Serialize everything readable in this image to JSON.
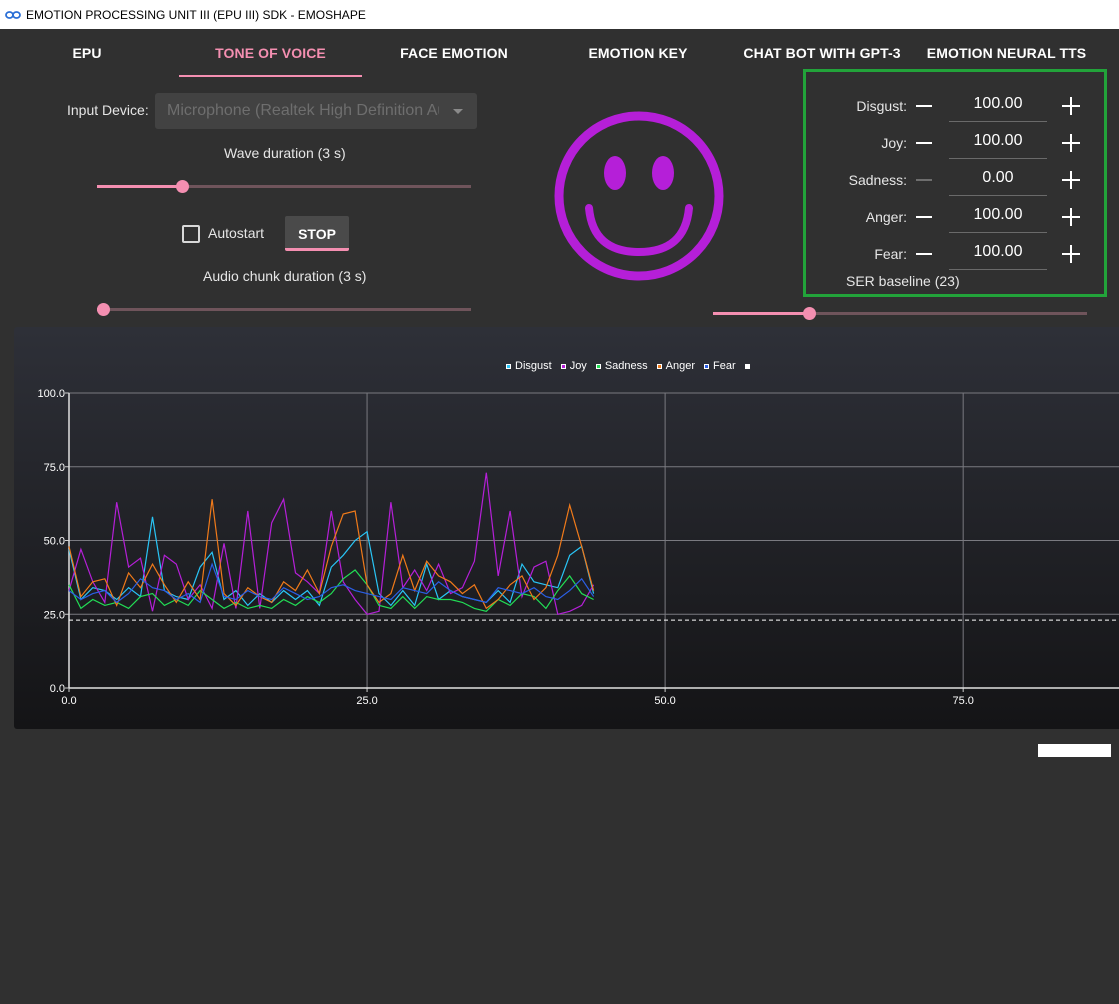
{
  "window": {
    "title": "EMOTION PROCESSING UNIT III (EPU III) SDK - EMOSHAPE",
    "icon": "infinity-icon"
  },
  "tabs": [
    {
      "label": "EPU",
      "active": false
    },
    {
      "label": "TONE OF VOICE",
      "active": true
    },
    {
      "label": "FACE EMOTION",
      "active": false
    },
    {
      "label": "EMOTION KEY",
      "active": false
    },
    {
      "label": "CHAT BOT WITH GPT-3",
      "active": false
    },
    {
      "label": "EMOTION NEURAL TTS",
      "active": false
    }
  ],
  "input_device": {
    "label": "Input Device:",
    "value": "Microphone (Realtek High Definition Audio)"
  },
  "wave_duration": {
    "label": "Wave duration (3 s)",
    "value": 3,
    "fraction": 0.21
  },
  "autostart": {
    "label": "Autostart",
    "checked": false
  },
  "stop_label": "STOP",
  "audio_chunk": {
    "label": "Audio chunk duration (3 s)",
    "value": 3,
    "fraction": 0.0
  },
  "face": {
    "expression": "happy",
    "color": "#b51fd8"
  },
  "emotions": [
    {
      "label": "Disgust:",
      "value": "100.00",
      "minus_enabled": true
    },
    {
      "label": "Joy:",
      "value": "100.00",
      "minus_enabled": true
    },
    {
      "label": "Sadness:",
      "value": "0.00",
      "minus_enabled": false
    },
    {
      "label": "Anger:",
      "value": "100.00",
      "minus_enabled": true
    },
    {
      "label": "Fear:",
      "value": "100.00",
      "minus_enabled": true
    }
  ],
  "ser_baseline": {
    "label": "SER baseline (23)",
    "value": 23,
    "fraction": 0.24
  },
  "colors": {
    "accent": "#f48fb1",
    "panel_border": "#22a33a",
    "background": "#303030"
  },
  "chart_data": {
    "type": "line",
    "title": "",
    "xlabel": "",
    "ylabel": "",
    "xlim": [
      0,
      90
    ],
    "ylim": [
      0,
      100
    ],
    "xticks": [
      "0.0",
      "25.0",
      "50.0",
      "75.0"
    ],
    "yticks": [
      "0.0",
      "25.0",
      "50.0",
      "75.0",
      "100.0"
    ],
    "grid": true,
    "legend_position": "top-center",
    "baseline": {
      "y": 23,
      "style": "dashed",
      "color": "#ffffff"
    },
    "x": [
      0,
      1,
      2,
      3,
      4,
      5,
      6,
      7,
      8,
      9,
      10,
      11,
      12,
      13,
      14,
      15,
      16,
      17,
      18,
      19,
      20,
      21,
      22,
      23,
      24,
      25,
      26,
      27,
      28,
      29,
      30,
      31,
      32,
      33,
      34,
      35,
      36,
      37,
      38,
      39,
      40,
      41,
      42,
      43,
      44
    ],
    "series": [
      {
        "name": "Disgust",
        "color": "#29c5f6",
        "values": [
          47,
          30,
          34,
          33,
          30,
          34,
          31,
          58,
          33,
          31,
          30,
          41,
          46,
          30,
          33,
          28,
          32,
          29,
          33,
          30,
          33,
          28,
          41,
          45,
          50,
          53,
          32,
          28,
          33,
          28,
          42,
          30,
          33,
          31,
          30,
          29,
          33,
          29,
          42,
          36,
          35,
          34,
          45,
          48,
          32
        ]
      },
      {
        "name": "Joy",
        "color": "#b51fd8",
        "values": [
          33,
          47,
          36,
          29,
          63,
          41,
          44,
          26,
          45,
          42,
          30,
          35,
          27,
          49,
          27,
          60,
          27,
          56,
          64,
          39,
          36,
          32,
          60,
          36,
          30,
          25,
          26,
          63,
          34,
          40,
          33,
          42,
          32,
          34,
          43,
          73,
          38,
          60,
          31,
          41,
          43,
          25,
          26,
          28,
          35
        ]
      },
      {
        "name": "Sadness",
        "color": "#22dd55",
        "values": [
          35,
          27,
          30,
          28,
          29,
          27,
          31,
          32,
          28,
          30,
          28,
          33,
          30,
          27,
          29,
          27,
          28,
          27,
          30,
          28,
          31,
          29,
          32,
          37,
          40,
          35,
          28,
          27,
          31,
          27,
          31,
          30,
          30,
          29,
          27,
          26,
          30,
          28,
          32,
          31,
          27,
          33,
          38,
          32,
          30
        ]
      },
      {
        "name": "Anger",
        "color": "#f07a1a",
        "values": [
          48,
          31,
          36,
          37,
          28,
          39,
          34,
          42,
          35,
          29,
          36,
          30,
          64,
          32,
          28,
          34,
          31,
          29,
          36,
          33,
          40,
          32,
          48,
          59,
          60,
          35,
          29,
          32,
          45,
          33,
          43,
          38,
          36,
          32,
          35,
          27,
          30,
          35,
          38,
          30,
          34,
          45,
          62,
          48,
          33
        ]
      },
      {
        "name": "Fear",
        "color": "#2b5fe5",
        "values": [
          33,
          30,
          32,
          33,
          29,
          32,
          37,
          34,
          33,
          30,
          32,
          29,
          42,
          31,
          30,
          33,
          31,
          30,
          34,
          32,
          30,
          31,
          34,
          35,
          33,
          32,
          31,
          30,
          34,
          33,
          32,
          36,
          33,
          31,
          30,
          29,
          34,
          33,
          32,
          34,
          31,
          30,
          33,
          37,
          31
        ]
      },
      {
        "name": "",
        "color": "#ffffff",
        "values": []
      }
    ]
  }
}
